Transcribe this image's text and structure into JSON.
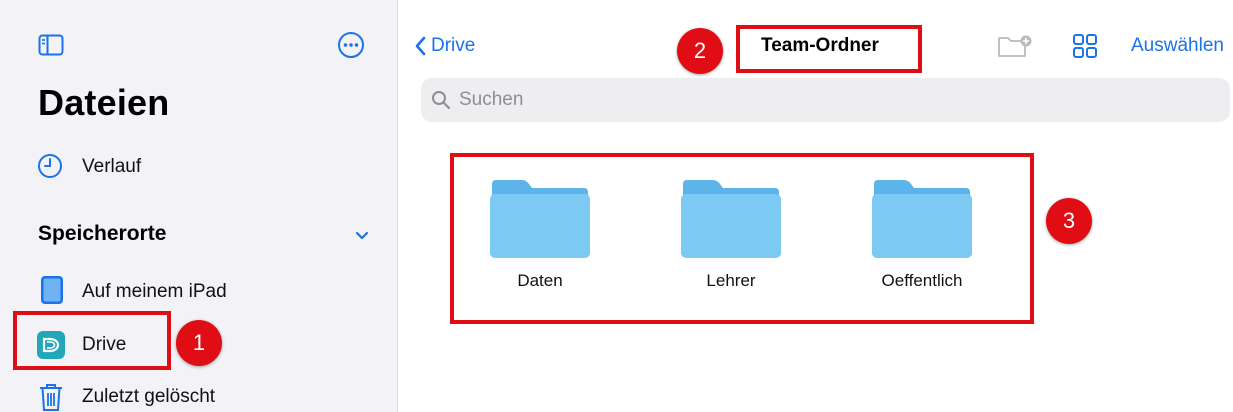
{
  "sidebar": {
    "title": "Dateien",
    "recents_label": "Verlauf",
    "section_title": "Speicherorte",
    "locations": [
      {
        "label": "Auf meinem iPad",
        "icon": "ipad-icon"
      },
      {
        "label": "Drive",
        "icon": "drive-app-icon"
      },
      {
        "label": "Zuletzt gelöscht",
        "icon": "trash-icon"
      }
    ]
  },
  "navbar": {
    "back_label": "Drive",
    "title": "Team-Ordner",
    "select_label": "Auswählen"
  },
  "search": {
    "placeholder": "Suchen"
  },
  "folders": [
    {
      "name": "Daten"
    },
    {
      "name": "Lehrer"
    },
    {
      "name": "Oeffentlich"
    }
  ],
  "annotations": [
    {
      "number": "1",
      "target": "Drive"
    },
    {
      "number": "2",
      "target": "Team-Ordner"
    },
    {
      "number": "3",
      "target": "folders"
    }
  ],
  "colors": {
    "accent": "#1a73e8",
    "highlight": "#e00d14",
    "folder": "#7cc9f4",
    "sidebar_bg": "#f2f2f7"
  }
}
